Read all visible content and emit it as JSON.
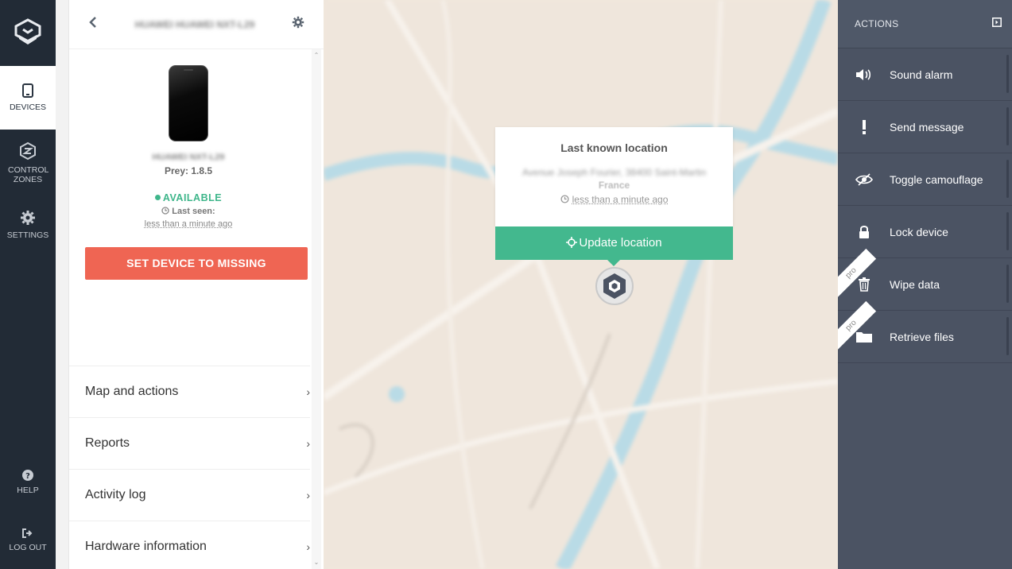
{
  "nav": {
    "items": [
      {
        "label": "DEVICES",
        "icon": "tablet-icon",
        "active": true
      },
      {
        "label": "CONTROL ZONES",
        "icon": "control-zones-icon"
      },
      {
        "label": "SETTINGS",
        "icon": "gear-icon"
      }
    ],
    "bottom": [
      {
        "label": "HELP",
        "icon": "question-icon"
      },
      {
        "label": "LOG OUT",
        "icon": "logout-icon"
      }
    ]
  },
  "device": {
    "header_title": "HUAWEI HUAWEI NXT-L29",
    "model": "HUAWEI NXT-L29",
    "prey_version": "Prey: 1.8.5",
    "status": "AVAILABLE",
    "last_seen_label": "Last seen:",
    "last_seen_time": "less than a minute ago",
    "missing_button": "SET DEVICE TO MISSING"
  },
  "menu": [
    {
      "label": "Map and actions"
    },
    {
      "label": "Reports"
    },
    {
      "label": "Activity log"
    },
    {
      "label": "Hardware information"
    }
  ],
  "map": {
    "popup_title": "Last known location",
    "address": "Avenue Joseph Fourier, 38400 Saint-Martin",
    "country": "France",
    "time": "less than a minute ago",
    "update_button": "Update location"
  },
  "actions": {
    "header": "ACTIONS",
    "items": [
      {
        "label": "Sound alarm",
        "icon": "speaker-icon",
        "pro": false
      },
      {
        "label": "Send message",
        "icon": "exclamation-icon",
        "pro": false
      },
      {
        "label": "Toggle camouflage",
        "icon": "eye-slash-icon",
        "pro": false
      },
      {
        "label": "Lock device",
        "icon": "lock-icon",
        "pro": false
      },
      {
        "label": "Wipe data",
        "icon": "trash-icon",
        "pro": true
      },
      {
        "label": "Retrieve files",
        "icon": "folder-icon",
        "pro": true
      }
    ],
    "pro_label": "pro"
  },
  "colors": {
    "nav_bg": "#222b36",
    "missing": "#ef6553",
    "available": "#3fb68b",
    "update": "#43b88e",
    "actions_bg": "#4b5363"
  }
}
